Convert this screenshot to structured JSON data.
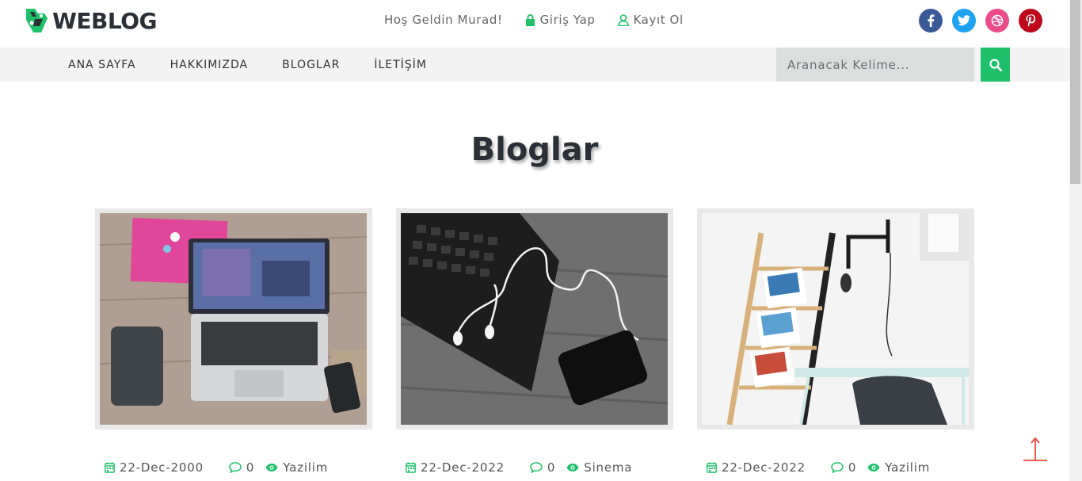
{
  "header": {
    "logo_text": "WEBLOG",
    "welcome": "Hoş Geldin Murad!",
    "login_label": "Giriş Yap",
    "register_label": "Kayıt Ol",
    "social": [
      {
        "name": "facebook",
        "color": "#3b5998"
      },
      {
        "name": "twitter",
        "color": "#1da1f2"
      },
      {
        "name": "dribbble",
        "color": "#ea4c89"
      },
      {
        "name": "pinterest",
        "color": "#bd081c"
      }
    ]
  },
  "nav": {
    "items": [
      {
        "label": "ANA SAYFA"
      },
      {
        "label": "HAKKIMIZDA"
      },
      {
        "label": "BLOGLAR"
      },
      {
        "label": "İLETİŞİM"
      }
    ],
    "search_placeholder": "Aranacak Kelime..."
  },
  "main": {
    "title": "Bloglar",
    "posts": [
      {
        "date": "22-Dec-2000",
        "comments": "0",
        "category": "Yazilim",
        "image": "laptop-desk-photo"
      },
      {
        "date": "22-Dec-2022",
        "comments": "0",
        "category": "Sinema",
        "image": "laptop-earphones-phone-photo"
      },
      {
        "date": "22-Dec-2022",
        "comments": "0",
        "category": "Yazilim",
        "image": "ladder-shelf-desk-photo"
      }
    ]
  },
  "theme": {
    "accent": "#1ec16a",
    "to_top_color": "#e74c3c"
  }
}
